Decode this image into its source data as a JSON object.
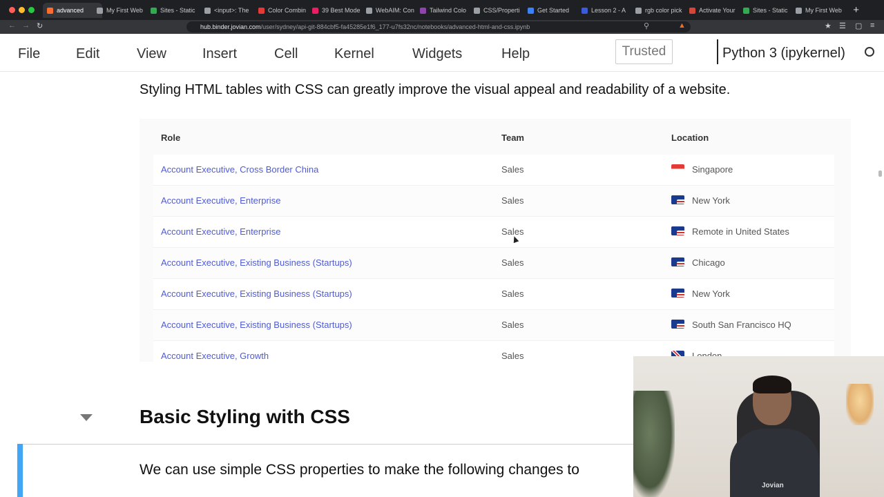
{
  "browser": {
    "tabs": [
      {
        "label": "advanced",
        "color": "#ff6d2e",
        "active": true
      },
      {
        "label": "My First Web",
        "color": "#9aa0a6"
      },
      {
        "label": "Sites - Static",
        "color": "#34a853"
      },
      {
        "label": "<input>: The",
        "color": "#9aa0a6"
      },
      {
        "label": "Color Combin",
        "color": "#e53935"
      },
      {
        "label": "39 Best Mode",
        "color": "#e91e63"
      },
      {
        "label": "WebAIM: Con",
        "color": "#9aa0a6"
      },
      {
        "label": "Tailwind Colo",
        "color": "#8e44ad"
      },
      {
        "label": "CSS/Properti",
        "color": "#9aa0a6"
      },
      {
        "label": "Get Started",
        "color": "#3b82f6"
      },
      {
        "label": "Lesson 2 - A",
        "color": "#3b5bdb"
      },
      {
        "label": "rgb color pick",
        "color": "#9aa0a6"
      },
      {
        "label": "Activate Your",
        "color": "#d44638"
      },
      {
        "label": "Sites - Static",
        "color": "#34a853"
      },
      {
        "label": "My First Web",
        "color": "#9aa0a6"
      }
    ],
    "url_host": "hub.binder.jovian.com",
    "url_path": "/user/sydney/api-git-884cbf5-fa45285e1f6_177-u7fs32nc/notebooks/advanced-html-and-css.ipynb"
  },
  "menu": {
    "items": [
      "File",
      "Edit",
      "View",
      "Insert",
      "Cell",
      "Kernel",
      "Widgets",
      "Help"
    ],
    "trusted": "Trusted",
    "kernel": "Python 3 (ipykernel)"
  },
  "content": {
    "intro": "Styling HTML tables with CSS can greatly improve the visual appeal and readability of a website.",
    "table": {
      "headers": [
        "Role",
        "Team",
        "Location"
      ],
      "rows": [
        {
          "role": "Account Executive, Cross Border China",
          "team": "Sales",
          "location": "Singapore",
          "flag": "sg"
        },
        {
          "role": "Account Executive, Enterprise",
          "team": "Sales",
          "location": "New York",
          "flag": "us"
        },
        {
          "role": "Account Executive, Enterprise",
          "team": "Sales",
          "location": "Remote in United States",
          "flag": "us"
        },
        {
          "role": "Account Executive, Existing Business (Startups)",
          "team": "Sales",
          "location": "Chicago",
          "flag": "us"
        },
        {
          "role": "Account Executive, Existing Business (Startups)",
          "team": "Sales",
          "location": "New York",
          "flag": "us"
        },
        {
          "role": "Account Executive, Existing Business (Startups)",
          "team": "Sales",
          "location": "South San Francisco HQ",
          "flag": "us"
        },
        {
          "role": "Account Executive, Growth",
          "team": "Sales",
          "location": "London",
          "flag": "gb"
        }
      ]
    },
    "heading": "Basic Styling with CSS",
    "paragraph": "We can use simple CSS properties to make the following changes to"
  },
  "webcam": {
    "logo": "Jovian"
  }
}
